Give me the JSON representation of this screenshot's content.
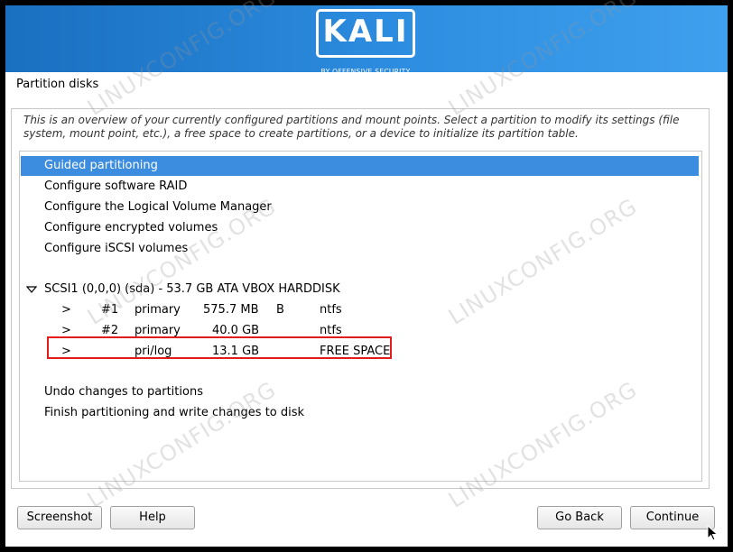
{
  "banner": {
    "logo_text": "KALI",
    "logo_subtext": "BY OFFENSIVE SECURITY",
    "gradient_start": "#1a6fc0",
    "gradient_end": "#3fa0ee"
  },
  "page_title": "Partition disks",
  "description": "This is an overview of your currently configured partitions and mount points. Select a partition to modify its settings (file system, mount point, etc.), a free space to create partitions, or a device to initialize its partition table.",
  "menu": [
    {
      "label": "Guided partitioning",
      "selected": true
    },
    {
      "label": "Configure software RAID"
    },
    {
      "label": "Configure the Logical Volume Manager"
    },
    {
      "label": "Configure encrypted volumes"
    },
    {
      "label": "Configure iSCSI volumes"
    }
  ],
  "disk": {
    "label": "SCSI1 (0,0,0) (sda) - 53.7 GB ATA VBOX HARDDISK",
    "expand_icon": "triangle-down-icon"
  },
  "partitions": [
    {
      "arrow": ">",
      "number": "#1",
      "type": "primary",
      "size": "575.7 MB",
      "flag": "B",
      "fs": "ntfs"
    },
    {
      "arrow": ">",
      "number": "#2",
      "type": "primary",
      "size": "40.0 GB",
      "flag": "",
      "fs": "ntfs"
    },
    {
      "arrow": ">",
      "number": "",
      "type": "pri/log",
      "size": "13.1 GB",
      "flag": "",
      "fs": "FREE SPACE",
      "highlighted": true
    }
  ],
  "actions": [
    {
      "label": "Undo changes to partitions"
    },
    {
      "label": "Finish partitioning and write changes to disk"
    }
  ],
  "buttons": {
    "screenshot": "Screenshot",
    "help": "Help",
    "go_back": "Go Back",
    "continue": "Continue"
  },
  "colors": {
    "selection": "#3c8de0",
    "highlight_border": "#e21b1b"
  }
}
